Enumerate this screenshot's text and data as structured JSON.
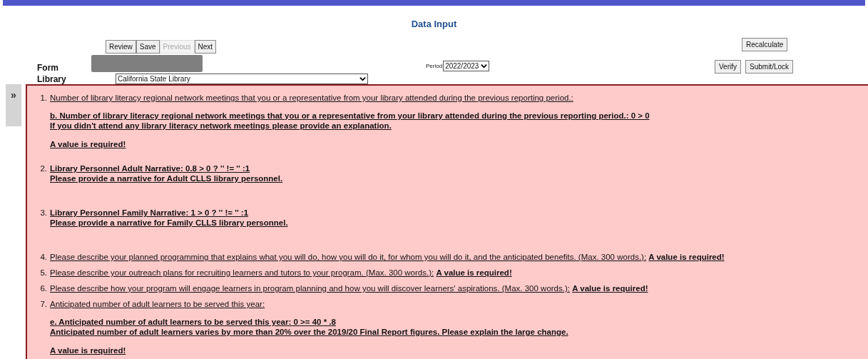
{
  "page_title": "Data Input",
  "nav_buttons": [
    {
      "label": "Review",
      "disabled": false
    },
    {
      "label": "Save",
      "disabled": false
    },
    {
      "label": "Previous",
      "disabled": true
    },
    {
      "label": "Next",
      "disabled": false
    }
  ],
  "recalculate_button": "Recalculate",
  "form_label": "Form",
  "library_label": "Library",
  "library_value": "California State Library",
  "period_label": "Period",
  "period_value": "2022/2023",
  "action_buttons": [
    "Verify",
    "Submit/Lock"
  ],
  "sidebar_toggle": "»",
  "errors": [
    {
      "number": "1.",
      "bold": false,
      "text": "Number of library literacy regional network meetings that you or a representative from your library attended during the previous reporting period.:",
      "details": [
        "b. Number of library literacy regional network meetings that you or a representative from your library attended during the previous reporting period.: 0 > 0",
        "If you didn't attend any library literacy network meetings please provide an explanation."
      ],
      "required": "A value is required!"
    },
    {
      "number": "2.",
      "text": "Library Personnel Adult Narrative: 0.8 > 0 ? '' != '' :1",
      "bold": true,
      "details": [
        "Please provide a narrative for Adult CLLS library personnel."
      ]
    },
    {
      "number": "3.",
      "text": "Library Personnel Family Narrative: 1 > 0 ? '' != '' :1",
      "bold": true,
      "details": [
        "Please provide a narrative for Family CLLS library personnel."
      ]
    },
    {
      "number": "4.",
      "bold": false,
      "text": "Please describe your planned programming that explains what you will do, how you will do it, for whom you will do it, and the anticipated benefits. (Max. 300 words.):",
      "inline_error": "A value is required!"
    },
    {
      "number": "5.",
      "bold": false,
      "text": "Please describe your outreach plans for recruiting learners and tutors to your program. (Max. 300 words.):",
      "inline_error": "A value is required!"
    },
    {
      "number": "6.",
      "bold": false,
      "text": "Please describe how your program will engage learners in program planning and how you will discover learners' aspirations. (Max. 300 words.):",
      "inline_error": "A value is required!"
    },
    {
      "number": "7.",
      "bold": false,
      "text": "Anticipated number of adult learners to be served this year:",
      "details": [
        "e. Anticipated number of adult learners to be served this year: 0 >= 40 * .8",
        "Anticipated number of adult learners varies by more than 20% over the 2019/20 Final Report figures. Please explain the large change."
      ],
      "required": "A value is required!"
    }
  ]
}
